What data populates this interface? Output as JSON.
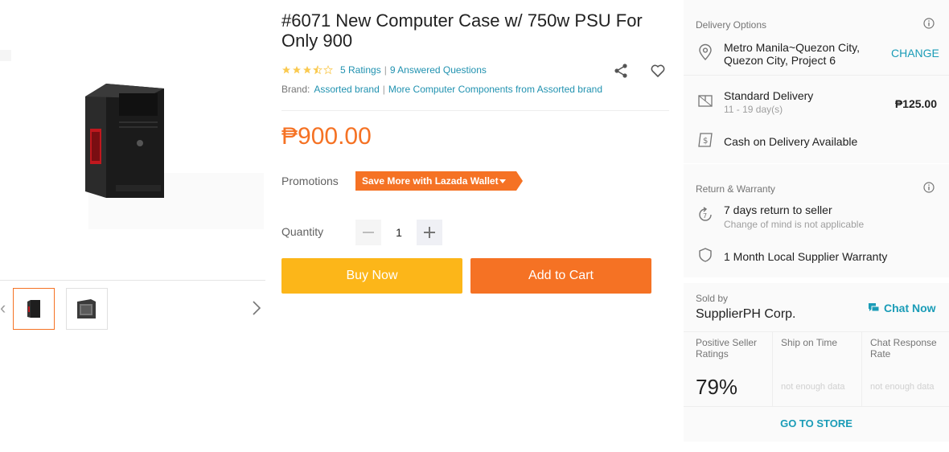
{
  "gallery": {
    "product_image": "computer-case-image",
    "thumbnails": [
      "computer-case-front",
      "computer-case-side"
    ],
    "prev_icon": "chevron-left-icon",
    "next_icon": "chevron-right-icon"
  },
  "product": {
    "title": "#6071 New Computer Case w/ 750w PSU For Only 900",
    "rating_stars": 3.5,
    "ratings_text": "5 Ratings",
    "questions_text": "9 Answered Questions",
    "brand_label": "Brand:",
    "brand_name": "Assorted brand",
    "more_from": "More Computer Components from Assorted brand",
    "price": "₱900.00",
    "promotions_label": "Promotions",
    "promo_badge": "Save More with Lazada Wallet",
    "quantity_label": "Quantity",
    "quantity": "1",
    "buy_now": "Buy Now",
    "add_to_cart": "Add to Cart"
  },
  "delivery": {
    "title": "Delivery Options",
    "location_line1": "Metro Manila~Quezon City,",
    "location_line2": "Quezon City, Project 6",
    "change": "CHANGE",
    "standard": "Standard Delivery",
    "standard_days": "11 - 19 day(s)",
    "standard_fee": "₱125.00",
    "cod": "Cash on Delivery Available"
  },
  "warranty": {
    "title": "Return & Warranty",
    "return_text": "7 days return to seller",
    "return_sub": "Change of mind is not applicable",
    "warranty_text": "1 Month Local Supplier Warranty"
  },
  "seller": {
    "sold_by": "Sold by",
    "name": "SupplierPH Corp.",
    "chat_now": "Chat Now",
    "metric1_label": "Positive Seller Ratings",
    "metric1_value": "79%",
    "metric2_label": "Ship on Time",
    "metric2_value": "not enough data",
    "metric3_label": "Chat Response Rate",
    "metric3_value": "not enough data",
    "go_to_store": "GO TO STORE"
  },
  "colors": {
    "accent": "#f57224",
    "buy": "#fcb619",
    "link": "#1a9cb7",
    "star": "#faca51"
  }
}
